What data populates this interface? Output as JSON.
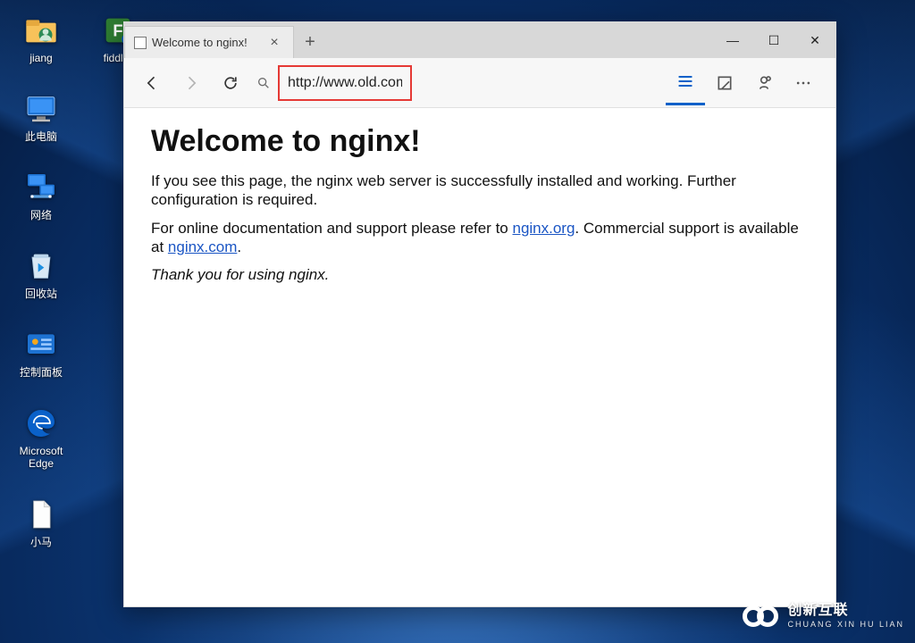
{
  "desktop": {
    "icons_col1": [
      {
        "name": "user-folder-icon",
        "label": "jiang",
        "glyph": "user-folder"
      },
      {
        "name": "this-pc-icon",
        "label": "此电脑",
        "glyph": "pc"
      },
      {
        "name": "network-icon",
        "label": "网络",
        "glyph": "network"
      },
      {
        "name": "recycle-bin-icon",
        "label": "回收站",
        "glyph": "recycle"
      },
      {
        "name": "control-panel-icon",
        "label": "控制面板",
        "glyph": "cpanel"
      },
      {
        "name": "edge-icon",
        "label": "Microsoft Edge",
        "glyph": "edge"
      },
      {
        "name": "file-icon",
        "label": "小马",
        "glyph": "file"
      }
    ],
    "icons_col2": [
      {
        "name": "fiddler-icon",
        "label": "fiddler",
        "glyph": "fiddler"
      }
    ]
  },
  "browser": {
    "tab_title": "Welcome to nginx!",
    "address": "http://www.old.com/",
    "nav": {
      "back": "←",
      "forward": "→",
      "refresh": "↻"
    },
    "window": {
      "min": "—",
      "max": "☐",
      "close": "✕"
    },
    "newtab": "+"
  },
  "page": {
    "heading": "Welcome to nginx!",
    "p1": "If you see this page, the nginx web server is successfully installed and working. Further configuration is required.",
    "p2_a": "For online documentation and support please refer to ",
    "p2_link1": "nginx.org",
    "p2_b": ". Commercial support is available at ",
    "p2_link2": "nginx.com",
    "p2_c": ".",
    "thanks": "Thank you for using nginx."
  },
  "watermark": {
    "big": "创新互联",
    "small": "CHUANG XIN HU LIAN"
  }
}
